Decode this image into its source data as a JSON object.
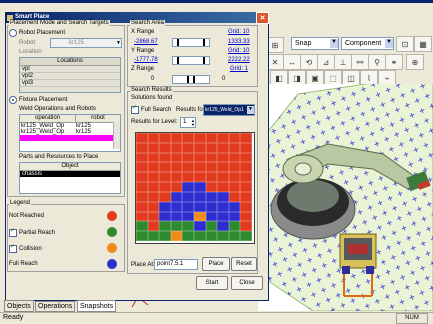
{
  "dialog": {
    "title": "Smart Place",
    "close_glyph": "✕"
  },
  "placement": {
    "group_title": "Placement Mode and Search Targets",
    "robot_placement": "Robot Placement",
    "robot_label": "Robot",
    "robot_value": "kr125",
    "location_label": "Location",
    "locations_header": "Locations",
    "locations": [
      "vpl",
      "vpl2",
      "vpl3"
    ],
    "fixture_placement": "Fixture Placement",
    "weld_ops_title": "Weld Operations and Robots",
    "weld_ops_headers": [
      "operation",
      "robot"
    ],
    "weld_ops_rows": [
      [
        "kr125_Weld_Op",
        "kr125"
      ],
      [
        "kr125_Weld_Op",
        "kr125"
      ]
    ],
    "parts_title": "Parts and Resources to Place",
    "parts_header": "Object",
    "parts_rows": [
      "chassis"
    ]
  },
  "legend": {
    "title": "Legend",
    "not_reached": "Not Reached",
    "partial_reach": "Partial Reach",
    "collision": "Collision",
    "full_reach": "Full Reach",
    "colors": {
      "not_reached": "#e23a1e",
      "partial_reach": "#2d8a2d",
      "collision": "#f08a18",
      "full_reach": "#2e2ed0"
    }
  },
  "tabs": [
    "Objects",
    "Operations",
    "Snapshots"
  ],
  "search_area": {
    "title": "Search Area",
    "x_label": "X Range",
    "x_min": "-2868.67",
    "x_max": "1333.33",
    "x_grid": "Grid: 10",
    "y_label": "Y Range",
    "y_min": "-1777.78",
    "y_max": "2222.22",
    "y_grid": "Grid: 10",
    "z_label": "Z Range",
    "z_min": "0",
    "z_max": "0",
    "z_grid": "Grid: 1"
  },
  "search_results": {
    "title": "Search Results",
    "solutions_found": "Solutions found",
    "full_search": "Full Search",
    "results_for_label": "Results for",
    "results_for_value": "kr125_Weld_Op1",
    "results_level_label": "Results for Level:",
    "results_level_value": "1",
    "grid": [
      "RRRRRRRRRR",
      "RRRRRRRRRR",
      "RRRRRRRRRR",
      "RRRRRRRRRR",
      "RRRRRRRRRR",
      "RRRRBBRRRR",
      "RRRBBBBBRR",
      "RRBBBBBBBR",
      "RRBBBOBBBR",
      "GRGGGBGBGR",
      "GGGOGGGGGG"
    ],
    "place_at_label": "Place At:",
    "place_at_value": "point7.5.1",
    "place_button": "Place",
    "reset_button": "Reset"
  },
  "footer": {
    "start": "Start",
    "close": "Close"
  },
  "toolbar": {
    "snap_label": "Snap",
    "component_label": "Component"
  },
  "statusbar": {
    "ready": "Ready",
    "num": "NUM"
  }
}
